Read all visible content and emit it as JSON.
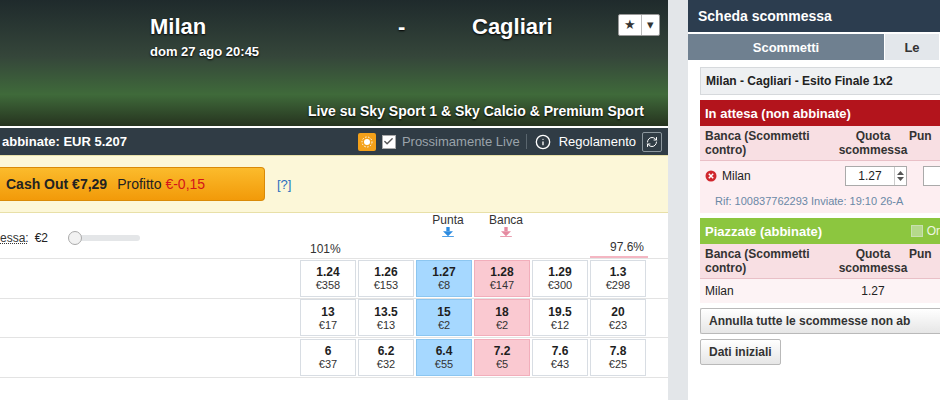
{
  "event": {
    "home": "Milan",
    "separator": "-",
    "away": "Cagliari",
    "datetime": "dom 27 ago 20:45",
    "broadcast": "Live su Sky Sport 1 & Sky Calcio & Premium Sport",
    "favourite_icon": "★",
    "menu_icon": "▾"
  },
  "matched_bar": {
    "label": "abbinate: EUR 5.207",
    "live_soon": {
      "label": "Prossimamente Live",
      "checked": true
    },
    "rules": "Regolamento"
  },
  "cash_out": {
    "button": "Cash Out €7,29",
    "profit_label": "Profitto",
    "profit_value": "€-0,15",
    "help": "[?]"
  },
  "stake": {
    "label": "essa:",
    "value": "€2",
    "level": 0.0
  },
  "market": {
    "back_label": "Punta",
    "lay_label": "Banca",
    "back_percent": "101%",
    "lay_percent": "97.6%",
    "runners": [
      {
        "prices": [
          {
            "odds": "1.24",
            "amount": "€358",
            "kind": "back",
            "best": false
          },
          {
            "odds": "1.26",
            "amount": "€153",
            "kind": "back",
            "best": false
          },
          {
            "odds": "1.27",
            "amount": "€8",
            "kind": "back",
            "best": true
          },
          {
            "odds": "1.28",
            "amount": "€147",
            "kind": "lay",
            "best": true
          },
          {
            "odds": "1.29",
            "amount": "€300",
            "kind": "lay",
            "best": false
          },
          {
            "odds": "1.3",
            "amount": "€298",
            "kind": "lay",
            "best": false
          }
        ]
      },
      {
        "prices": [
          {
            "odds": "13",
            "amount": "€17",
            "kind": "back",
            "best": false
          },
          {
            "odds": "13.5",
            "amount": "€13",
            "kind": "back",
            "best": false
          },
          {
            "odds": "15",
            "amount": "€2",
            "kind": "back",
            "best": true
          },
          {
            "odds": "18",
            "amount": "€2",
            "kind": "lay",
            "best": true
          },
          {
            "odds": "19.5",
            "amount": "€12",
            "kind": "lay",
            "best": false
          },
          {
            "odds": "20",
            "amount": "€23",
            "kind": "lay",
            "best": false
          }
        ]
      },
      {
        "prices": [
          {
            "odds": "6",
            "amount": "€37",
            "kind": "back",
            "best": false
          },
          {
            "odds": "6.2",
            "amount": "€32",
            "kind": "back",
            "best": false
          },
          {
            "odds": "6.4",
            "amount": "€55",
            "kind": "back",
            "best": true
          },
          {
            "odds": "7.2",
            "amount": "€5",
            "kind": "lay",
            "best": true
          },
          {
            "odds": "7.6",
            "amount": "€43",
            "kind": "lay",
            "best": false
          },
          {
            "odds": "7.8",
            "amount": "€25",
            "kind": "lay",
            "best": false
          }
        ]
      }
    ]
  },
  "bet_slip": {
    "title": "Scheda scommessa",
    "tabs": [
      {
        "label": "Scommetti",
        "selected": true
      },
      {
        "label": "Le",
        "selected": false
      }
    ],
    "market": "Milan - Cagliari - Esito Finale 1x2",
    "unmatched": {
      "title": "In attesa (non abbinate)",
      "columns": [
        "Banca (Scommetti contro)",
        "Quota scommessa",
        "Pun"
      ],
      "bets": [
        {
          "runner": "Milan",
          "odds": "1.27",
          "stake": "",
          "reference": "Rif: 100837762293 Inviate: 19:10 26-A"
        }
      ]
    },
    "matched": {
      "title": "Piazzate (abbinate)",
      "option": {
        "label": "Or",
        "checked": false
      },
      "columns": [
        "Banca (Scommetti contro)",
        "Quota scommessa",
        "Pun"
      ],
      "bets": [
        {
          "runner": "Milan",
          "odds": "1.27"
        }
      ]
    },
    "buttons": [
      "Annulla tutte le scommesse non ab",
      "Dati iniziali"
    ]
  }
}
